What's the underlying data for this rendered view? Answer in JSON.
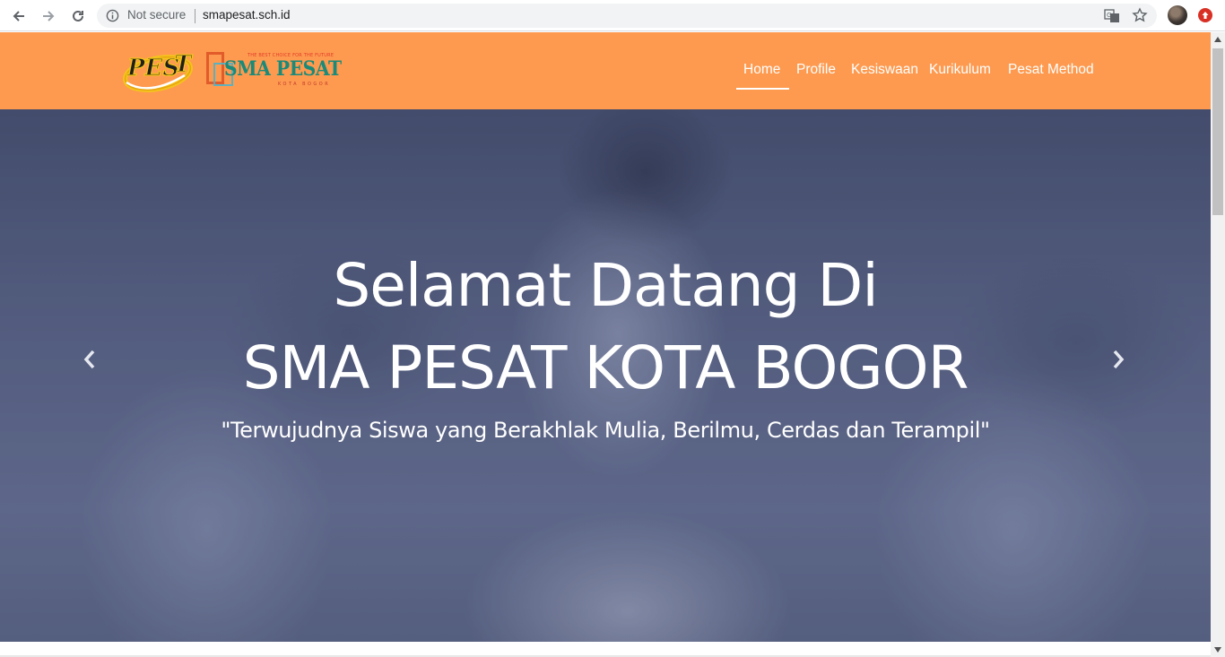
{
  "browser": {
    "security_label": "Not secure",
    "url": "smapesat.sch.id"
  },
  "site": {
    "logos": {
      "pest_text": "PES T",
      "sma_tagline": "THE BEST CHOICE FOR THE FUTURE",
      "sma_name": "SMA PESAT",
      "sma_sub": "KOTA BOGOR"
    },
    "menu": [
      {
        "label": "Home",
        "active": true
      },
      {
        "label": "Profile",
        "active": false
      },
      {
        "label": "Kesiswaan",
        "active": false
      },
      {
        "label": "Kurikulum",
        "active": false
      },
      {
        "label": "Pesat Method",
        "active": false
      }
    ]
  },
  "hero": {
    "title_line1": "Selamat Datang Di",
    "title_line2": "SMA PESAT KOTA BOGOR",
    "tagline": "\"Terwujudnya Siswa yang Berakhlak Mulia, Berilmu, Cerdas dan Terampil\""
  },
  "colors": {
    "header_bg": "#fe9a4f",
    "menu_text": "#ffffff",
    "hero_overlay": "#4a5273"
  },
  "icons": {
    "back": "arrow-left-icon",
    "forward": "arrow-right-icon",
    "reload": "reload-icon",
    "info": "info-icon",
    "translate": "translate-icon",
    "star": "star-icon",
    "prev": "chevron-left-icon",
    "next": "chevron-right-icon"
  }
}
